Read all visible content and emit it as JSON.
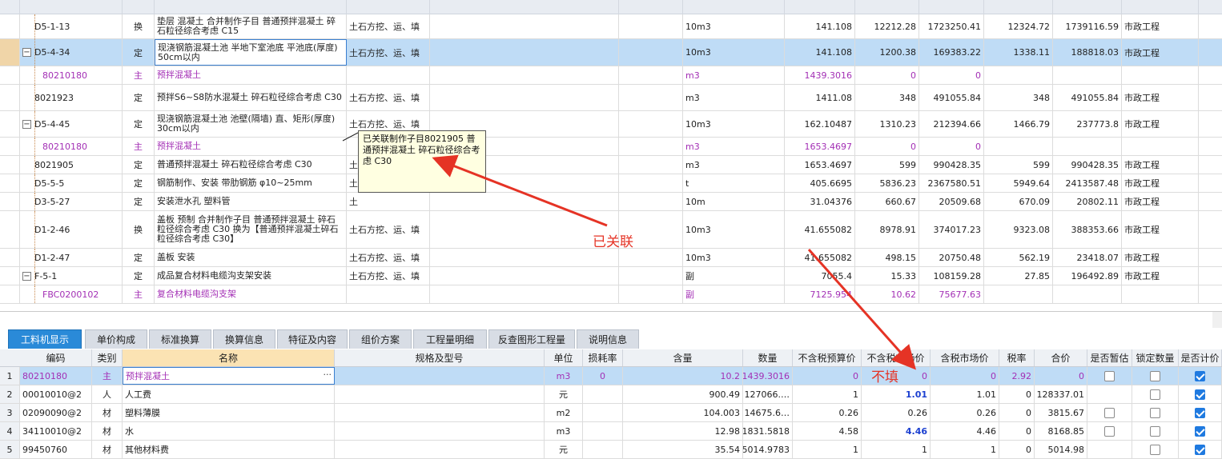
{
  "upper_rows": [
    {
      "code": "D5-1-13",
      "type": "换",
      "name": "垫层 混凝土  合并制作子目 普通预拌混凝土 碎石粒径综合考虑 C15",
      "feature": "土石方挖、运、填",
      "unit": "10m3",
      "qty": "141.108",
      "price": "12212.28",
      "total": "1723250.41",
      "tax_price": "12324.72",
      "tax_total": "1739116.59",
      "category": "市政工程"
    },
    {
      "code": "D5-4-34",
      "type": "定",
      "name": "现浇钢筋混凝土池 半地下室池底 平池底(厚度) 50cm以内",
      "feature": "土石方挖、运、填",
      "unit": "10m3",
      "qty": "141.108",
      "price": "1200.38",
      "total": "169383.22",
      "tax_price": "1338.11",
      "tax_total": "188818.03",
      "category": "市政工程"
    },
    {
      "code": "80210180",
      "type": "主",
      "name": "预拌混凝土",
      "feature": "",
      "unit": "m3",
      "qty": "1439.3016",
      "price": "0",
      "total": "0",
      "tax_price": "",
      "tax_total": "",
      "category": ""
    },
    {
      "code": "8021923",
      "type": "定",
      "name": "预拌S6~S8防水混凝土 碎石粒径综合考虑 C30",
      "feature": "土石方挖、运、填",
      "unit": "m3",
      "qty": "1411.08",
      "price": "348",
      "total": "491055.84",
      "tax_price": "348",
      "tax_total": "491055.84",
      "category": "市政工程"
    },
    {
      "code": "D5-4-45",
      "type": "定",
      "name": "现浇钢筋混凝土池 池壁(隔墙) 直、矩形(厚度) 30cm以内",
      "feature": "土石方挖、运、填",
      "unit": "10m3",
      "qty": "162.10487",
      "price": "1310.23",
      "total": "212394.66",
      "tax_price": "1466.79",
      "tax_total": "237773.8",
      "category": "市政工程"
    },
    {
      "code": "80210180",
      "type": "主",
      "name": "预拌混凝土",
      "feature": "",
      "unit": "m3",
      "qty": "1653.4697",
      "price": "0",
      "total": "0",
      "tax_price": "",
      "tax_total": "",
      "category": ""
    },
    {
      "code": "8021905",
      "type": "定",
      "name": "普通预拌混凝土 碎石粒径综合考虑 C30",
      "feature": "土",
      "unit": "m3",
      "qty": "1653.4697",
      "price": "599",
      "total": "990428.35",
      "tax_price": "599",
      "tax_total": "990428.35",
      "category": "市政工程"
    },
    {
      "code": "D5-5-5",
      "type": "定",
      "name": "钢筋制作、安装 带肋钢筋 φ10~25mm",
      "feature": "土",
      "unit": "t",
      "qty": "405.6695",
      "price": "5836.23",
      "total": "2367580.51",
      "tax_price": "5949.64",
      "tax_total": "2413587.48",
      "category": "市政工程"
    },
    {
      "code": "D3-5-27",
      "type": "定",
      "name": "安装泄水孔 塑料管",
      "feature": "土",
      "unit": "10m",
      "qty": "31.04376",
      "price": "660.67",
      "total": "20509.68",
      "tax_price": "670.09",
      "tax_total": "20802.11",
      "category": "市政工程"
    },
    {
      "code": "D1-2-46",
      "type": "换",
      "name": "盖板 预制  合并制作子目 普通预拌混凝土 碎石粒径综合考虑 C30   换为【普通预拌混凝土碎石粒径综合考虑 C30】",
      "feature": "土石方挖、运、填",
      "unit": "10m3",
      "qty": "41.655082",
      "price": "8978.91",
      "total": "374017.23",
      "tax_price": "9323.08",
      "tax_total": "388353.66",
      "category": "市政工程"
    },
    {
      "code": "D1-2-47",
      "type": "定",
      "name": "盖板 安装",
      "feature": "土石方挖、运、填",
      "unit": "10m3",
      "qty": "41.655082",
      "price": "498.15",
      "total": "20750.48",
      "tax_price": "562.19",
      "tax_total": "23418.07",
      "category": "市政工程"
    },
    {
      "code": "F-5-1",
      "type": "定",
      "name": "成品复合材料电缆沟支架安装",
      "feature": "土石方挖、运、填",
      "unit": "副",
      "qty": "7055.4",
      "price": "15.33",
      "total": "108159.28",
      "tax_price": "27.85",
      "tax_total": "196492.89",
      "category": "市政工程"
    },
    {
      "code": "FBC0200102",
      "type": "主",
      "name": "复合材料电缆沟支架",
      "feature": "",
      "unit": "副",
      "qty": "7125.954",
      "price": "10.62",
      "total": "75677.63",
      "tax_price": "",
      "tax_total": "",
      "category": ""
    }
  ],
  "tooltip": "已关联制作子目8021905 普通预拌混凝土 碎石粒径综合考虑 C30",
  "annotations": {
    "linked": "已关联",
    "not_fill": "不填"
  },
  "tabs": [
    "工料机显示",
    "单价构成",
    "标准换算",
    "换算信息",
    "特征及内容",
    "组价方案",
    "工程量明细",
    "反查图形工程量",
    "说明信息"
  ],
  "bottom_headers": [
    "编码",
    "类别",
    "名称",
    "规格及型号",
    "单位",
    "损耗率",
    "含量",
    "数量",
    "不含税预算价",
    "不含税市场价",
    "含税市场价",
    "税率",
    "合价",
    "是否暂估",
    "锁定数量",
    "是否计价"
  ],
  "bottom_rows": [
    {
      "num": "1",
      "code": "80210180",
      "type": "主",
      "name": "预拌混凝土",
      "spec": "",
      "unit": "m3",
      "loss": "0",
      "content": "10.2",
      "qty": "1439.3016",
      "budget": "0",
      "market": "0",
      "tax_market": "0",
      "rate": "2.92",
      "total": "0",
      "est": false,
      "lock": false,
      "count": true
    },
    {
      "num": "2",
      "code": "00010010@2",
      "type": "人",
      "name": "人工费",
      "spec": "",
      "unit": "元",
      "loss": "",
      "content": "900.49",
      "qty": "127066.…",
      "budget": "1",
      "market": "1.01",
      "tax_market": "1.01",
      "rate": "0",
      "total": "128337.01",
      "est": null,
      "lock": false,
      "count": true
    },
    {
      "num": "3",
      "code": "02090090@2",
      "type": "材",
      "name": "塑料薄膜",
      "spec": "",
      "unit": "m2",
      "loss": "",
      "content": "104.003",
      "qty": "14675.6…",
      "budget": "0.26",
      "market": "0.26",
      "tax_market": "0.26",
      "rate": "0",
      "total": "3815.67",
      "est": false,
      "lock": false,
      "count": true
    },
    {
      "num": "4",
      "code": "34110010@2",
      "type": "材",
      "name": "水",
      "spec": "",
      "unit": "m3",
      "loss": "",
      "content": "12.98",
      "qty": "1831.5818",
      "budget": "4.58",
      "market": "4.46",
      "tax_market": "4.46",
      "rate": "0",
      "total": "8168.85",
      "est": false,
      "lock": false,
      "count": true
    },
    {
      "num": "5",
      "code": "99450760",
      "type": "材",
      "name": "其他材料费",
      "spec": "",
      "unit": "元",
      "loss": "",
      "content": "35.54",
      "qty": "5014.9783",
      "budget": "1",
      "market": "1",
      "tax_market": "1",
      "rate": "0",
      "total": "5014.98",
      "est": null,
      "lock": false,
      "count": true
    }
  ],
  "colors": {
    "accent": "#2a8ad8",
    "annotation": "#e53325",
    "selected_row": "#bfdcf6",
    "main_material": "#a32fb5"
  }
}
